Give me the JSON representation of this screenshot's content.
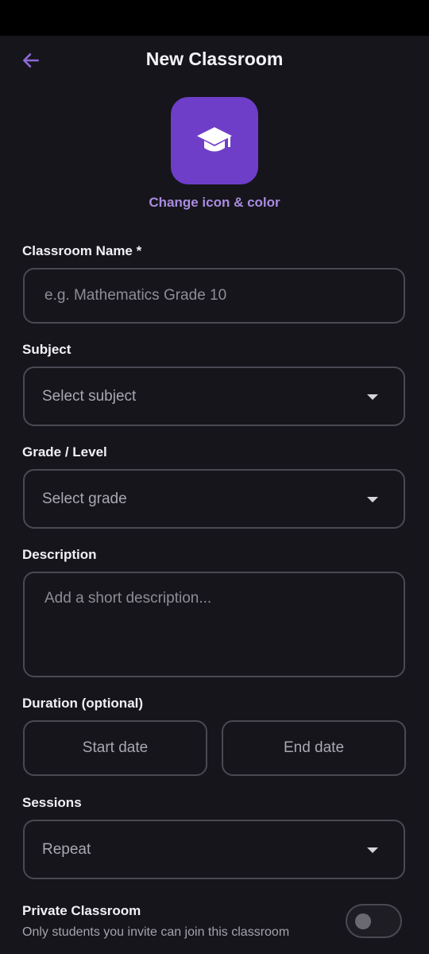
{
  "app": {
    "title": "New Classroom"
  },
  "icon": {
    "name": "graduation-cap-icon",
    "color": "#6e3ec8",
    "change_label": "Change icon & color"
  },
  "form": {
    "name": {
      "label": "Classroom Name *",
      "placeholder": "e.g. Mathematics Grade 10"
    },
    "subject": {
      "label": "Subject",
      "value": "Select subject"
    },
    "grade": {
      "label": "Grade / Level",
      "value": "Select grade"
    },
    "description": {
      "label": "Description",
      "placeholder": "Add a short description..."
    },
    "duration": {
      "label": "Duration (optional)",
      "start": "Start date",
      "end": "End date"
    },
    "sessions": {
      "label": "Sessions",
      "value": "Repeat"
    },
    "private": {
      "label": "Private Classroom",
      "description": "Only students you invite can join this classroom",
      "enabled": false
    }
  },
  "colors": {
    "accent": "#8b6ad8",
    "tile": "#6e3ec8",
    "background": "#16151b",
    "border": "#4a4952"
  }
}
